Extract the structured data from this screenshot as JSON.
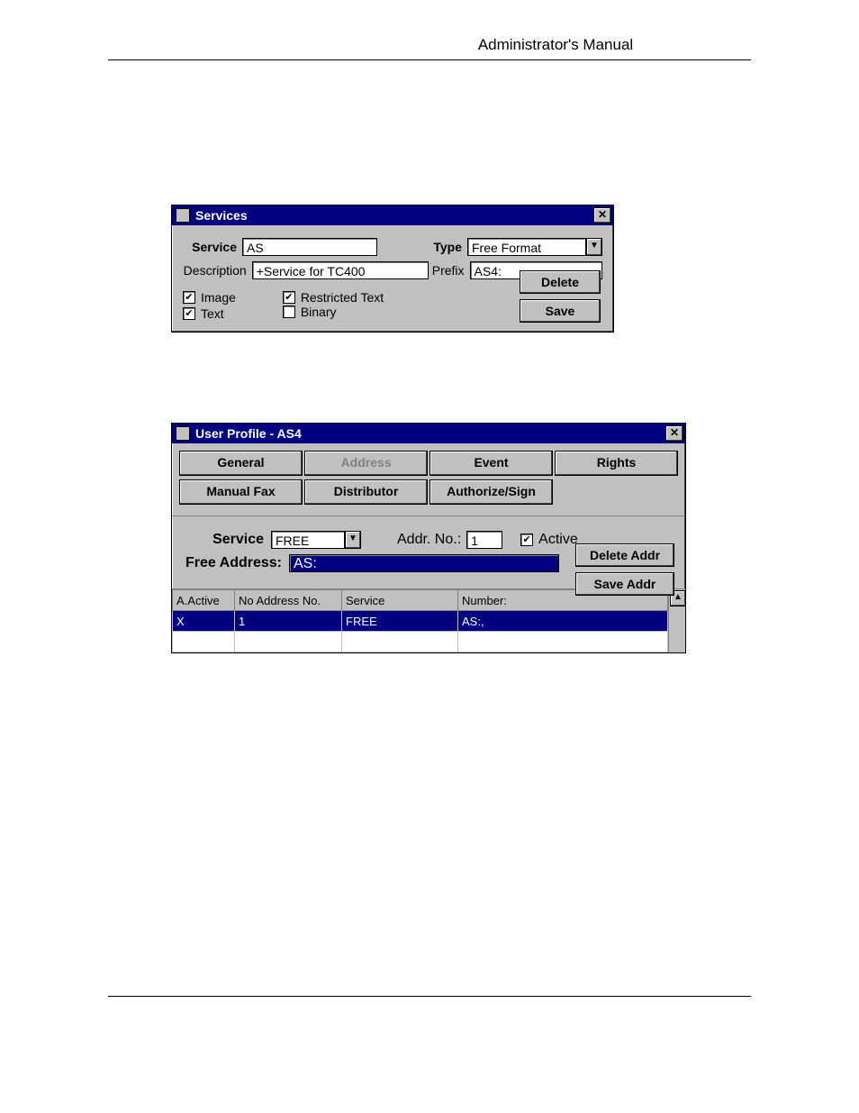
{
  "header": {
    "title": "Administrator's Manual"
  },
  "services": {
    "window_title": "Services",
    "service_label": "Service",
    "service_value": "AS",
    "type_label": "Type",
    "type_value": "Free Format",
    "description_label": "Description",
    "description_value": "+Service for TC400",
    "prefix_label": "Prefix",
    "prefix_value": "AS4:",
    "checks": {
      "image": {
        "label": "Image",
        "checked": true
      },
      "text": {
        "label": "Text",
        "checked": true
      },
      "restricted": {
        "label": "Restricted Text",
        "checked": true
      },
      "binary": {
        "label": "Binary",
        "checked": false
      }
    },
    "buttons": {
      "delete": "Delete",
      "save": "Save"
    }
  },
  "profile": {
    "window_title": "User Profile - AS4",
    "tabs": {
      "general": "General",
      "address": "Address",
      "event": "Event",
      "rights": "Rights",
      "manual_fax": "Manual Fax",
      "distributor": "Distributor",
      "authorize": "Authorize/Sign"
    },
    "form": {
      "service_label": "Service",
      "service_value": "FREE",
      "addr_no_label": "Addr. No.:",
      "addr_no_value": "1",
      "active_label": "Active",
      "active_checked": true,
      "free_address_label": "Free Address:",
      "free_address_value": "AS:",
      "buttons": {
        "delete_addr": "Delete Addr",
        "save_addr": "Save Addr"
      }
    },
    "grid": {
      "headers": {
        "active": "A.Active",
        "no": "No Address No.",
        "service": "Service",
        "number": "Number:"
      },
      "rows": [
        {
          "active": "X",
          "no": "1",
          "service": "FREE",
          "number": "AS:,"
        }
      ]
    }
  }
}
